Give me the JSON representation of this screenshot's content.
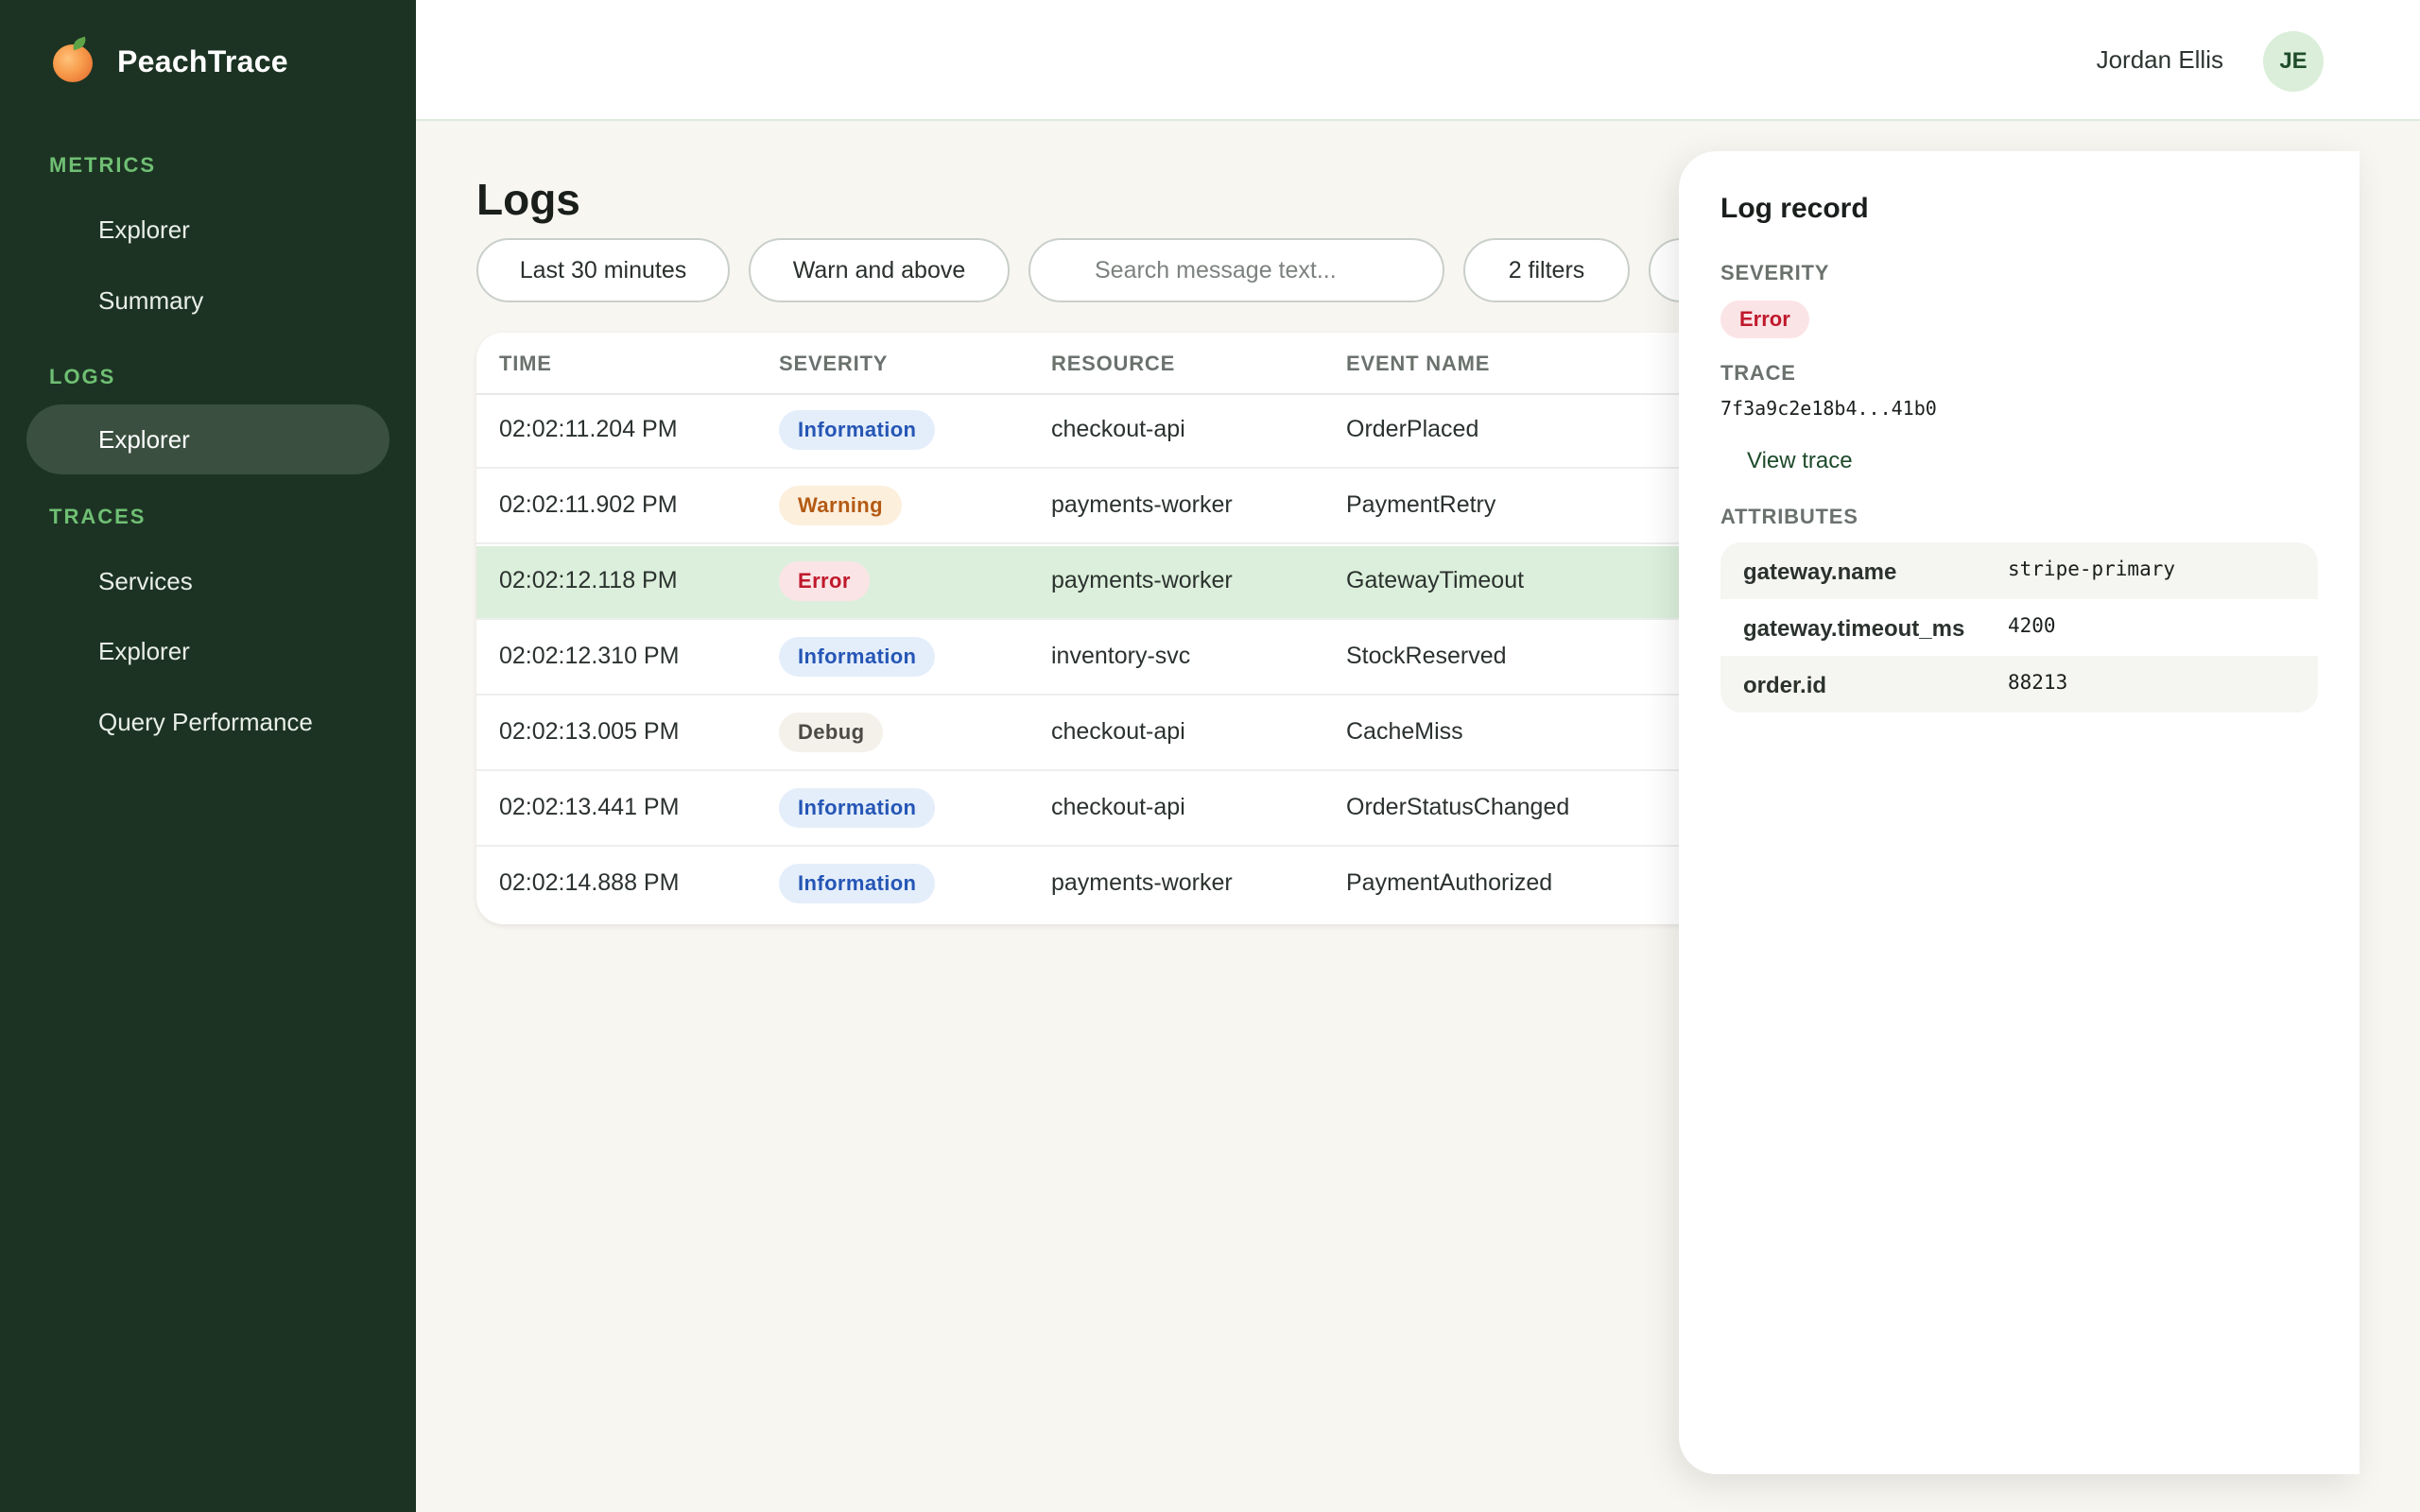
{
  "brand": {
    "name": "PeachTrace",
    "logo_icon": "peach-icon"
  },
  "sidebar": {
    "sections": [
      {
        "label": "METRICS",
        "items": [
          {
            "label": "Explorer"
          },
          {
            "label": "Summary"
          }
        ]
      },
      {
        "label": "LOGS",
        "items": [
          {
            "label": "Explorer",
            "active": true
          }
        ]
      },
      {
        "label": "TRACES",
        "items": [
          {
            "label": "Services"
          },
          {
            "label": "Explorer"
          },
          {
            "label": "Query Performance"
          }
        ]
      }
    ]
  },
  "header": {
    "user_name": "Jordan Ellis",
    "avatar_initials": "JE"
  },
  "main": {
    "title": "Logs",
    "filters": {
      "time_range": "Last 30 minutes",
      "severity": "Warn and above",
      "search_placeholder": "Search message text...",
      "filter_count": "2 filters"
    },
    "table": {
      "columns": [
        "TIME",
        "SEVERITY",
        "RESOURCE",
        "EVENT NAME"
      ],
      "rows": [
        {
          "time": "02:02:11.204 PM",
          "severity": "Information",
          "resource": "checkout-api",
          "event": "OrderPlaced"
        },
        {
          "time": "02:02:11.902 PM",
          "severity": "Warning",
          "resource": "payments-worker",
          "event": "PaymentRetry"
        },
        {
          "time": "02:02:12.118 PM",
          "severity": "Error",
          "resource": "payments-worker",
          "event": "GatewayTimeout",
          "selected": true
        },
        {
          "time": "02:02:12.310 PM",
          "severity": "Information",
          "resource": "inventory-svc",
          "event": "StockReserved"
        },
        {
          "time": "02:02:13.005 PM",
          "severity": "Debug",
          "resource": "checkout-api",
          "event": "CacheMiss"
        },
        {
          "time": "02:02:13.441 PM",
          "severity": "Information",
          "resource": "checkout-api",
          "event": "OrderStatusChanged"
        },
        {
          "time": "02:02:14.888 PM",
          "severity": "Information",
          "resource": "payments-worker",
          "event": "PaymentAuthorized"
        }
      ]
    }
  },
  "detail": {
    "title": "Log record",
    "severity_label": "SEVERITY",
    "severity_value": "Error",
    "trace_label": "TRACE",
    "trace_id": "7f3a9c2e18b4...41b0",
    "view_trace": "View trace",
    "attributes_label": "ATTRIBUTES",
    "attributes": [
      {
        "key": "gateway.name",
        "value": "stripe-primary"
      },
      {
        "key": "gateway.timeout_ms",
        "value": "4200"
      },
      {
        "key": "order.id",
        "value": "88213"
      }
    ]
  },
  "colors": {
    "sidebar_bg": "#1c3323",
    "sidebar_section": "#6fbf73",
    "active_nav_bg": "#3a4f3f",
    "selected_row_bg": "#dcefdc",
    "info_badge": "#2556b5",
    "warning_badge": "#b45a14",
    "error_badge": "#c0192c",
    "debug_badge": "#4b4a44"
  }
}
